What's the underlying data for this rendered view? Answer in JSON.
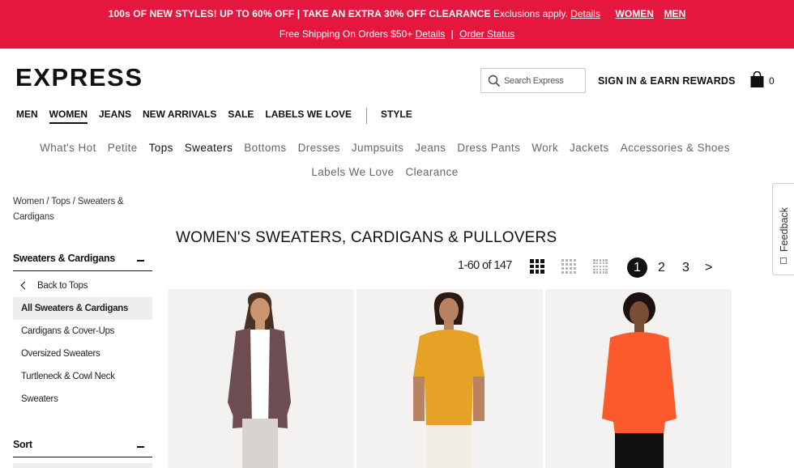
{
  "promo": {
    "headline": "100s OF NEW STYLES! UP TO 60% OFF | TAKE AN EXTRA 30% OFF CLEARANCE",
    "exclusions": "Exclusions apply.",
    "details_link": "Details",
    "women_link": "WOMEN",
    "men_link": "MEN",
    "shipping_text": "Free Shipping On Orders $50+",
    "shipping_details_link": "Details",
    "divider": "|",
    "order_status_link": "Order Status",
    "color": "#e5173f"
  },
  "header": {
    "logo": "EXPRESS",
    "search_placeholder": "Search Express",
    "signin": "SIGN IN & EARN REWARDS",
    "bag_count": "0"
  },
  "main_nav": {
    "items": [
      "MEN",
      "WOMEN",
      "JEANS",
      "NEW ARRIVALS",
      "SALE",
      "LABELS WE LOVE"
    ],
    "active": "WOMEN",
    "style_link": "STYLE"
  },
  "sub_nav": {
    "items": [
      "What's Hot",
      "Petite",
      "Tops",
      "Sweaters",
      "Bottoms",
      "Dresses",
      "Jumpsuits",
      "Jeans",
      "Dress Pants",
      "Work",
      "Jackets",
      "Accessories & Shoes",
      "Labels We Love",
      "Clearance"
    ]
  },
  "breadcrumb": {
    "items": [
      "Women",
      "Tops",
      "Sweaters & Cardigans"
    ],
    "separator": "/"
  },
  "sidebar": {
    "category_heading": "Sweaters & Cardigans",
    "back_link": "Back to Tops",
    "items": [
      "All Sweaters & Cardigans",
      "Cardigans & Cover-Ups",
      "Oversized Sweaters",
      "Turtleneck & Cowl Neck",
      "Sweaters"
    ],
    "selected": "All Sweaters & Cardigans",
    "sort_heading": "Sort"
  },
  "listing": {
    "title": "WOMEN'S SWEATERS, CARDIGANS & PULLOVERS",
    "count": "1-60 of 147",
    "pages": [
      "1",
      "2",
      "3"
    ],
    "current_page": "1",
    "next": ">"
  },
  "products": [
    {
      "top_color": "#6e4d52",
      "inner_color": "#ffffff",
      "bottom_color": "#d7d4d0",
      "skin_color": "#c9966f",
      "hair_color": "#4a3222"
    },
    {
      "top_color": "#e6a226",
      "inner_color": "#e6a226",
      "bottom_color": "#f2ede6",
      "skin_color": "#b98362",
      "hair_color": "#2a1a12"
    },
    {
      "top_color": "#fb5a2d",
      "inner_color": "#fb5a2d",
      "bottom_color": "#111111",
      "skin_color": "#7a4e35",
      "hair_color": "#1a1110"
    }
  ],
  "feedback": {
    "label": "Feedback"
  }
}
